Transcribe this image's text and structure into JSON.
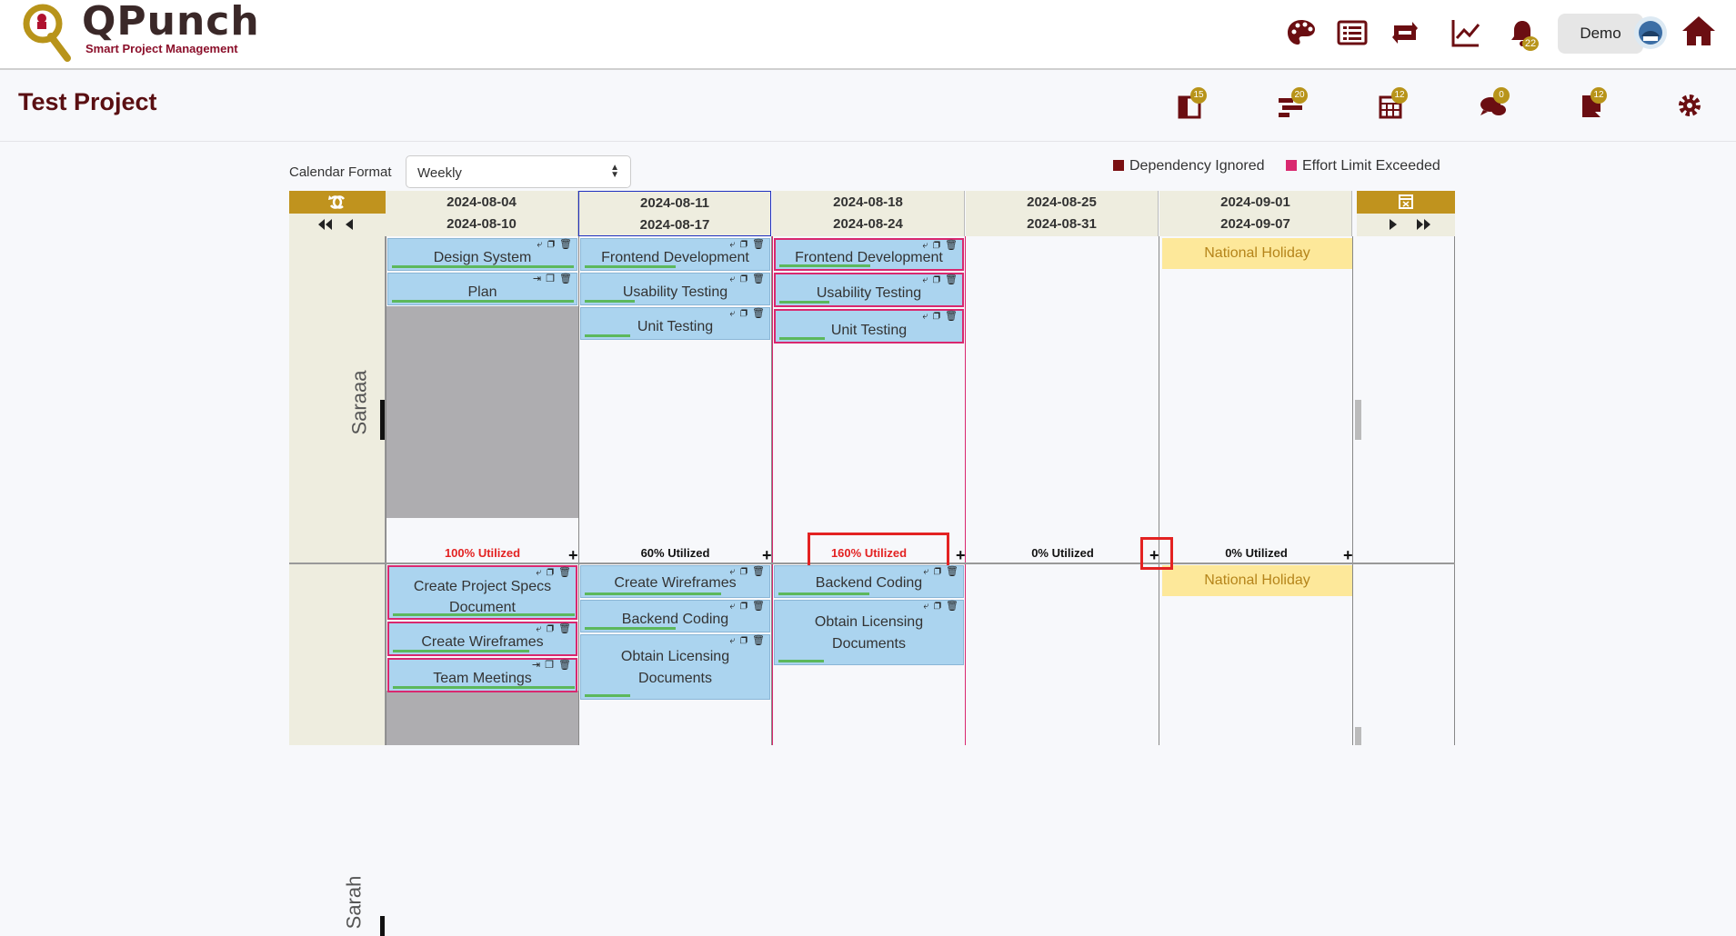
{
  "app": {
    "logo_title": "QPunch",
    "logo_subtitle": "Smart Project Management"
  },
  "topnav": {
    "demo_label": "Demo",
    "notification_count": "22",
    "icons": [
      "dashboard-icon",
      "list-icon",
      "repeat-icon",
      "chart-icon",
      "bell-icon",
      "avatar",
      "home-icon"
    ]
  },
  "project": {
    "title": "Test Project"
  },
  "project_toolbar": {
    "items": [
      {
        "icon": "tasks-board-icon",
        "count": "15"
      },
      {
        "icon": "gantt-icon",
        "count": "20"
      },
      {
        "icon": "calendar-icon",
        "count": "12"
      },
      {
        "icon": "chat-icon",
        "count": "0"
      },
      {
        "icon": "bookmark-icon",
        "count": "12"
      },
      {
        "icon": "gear-icon",
        "count": ""
      }
    ]
  },
  "calendar_format": {
    "label": "Calendar Format",
    "value": "Weekly"
  },
  "legend": [
    {
      "label": "Dependency Ignored",
      "color": "#7a0f12"
    },
    {
      "label": "Effort Limit Exceeded",
      "color": "#d9286f"
    }
  ],
  "weeks": [
    {
      "start": "2024-08-04",
      "end": "2024-08-10"
    },
    {
      "start": "2024-08-11",
      "end": "2024-08-17"
    },
    {
      "start": "2024-08-18",
      "end": "2024-08-24"
    },
    {
      "start": "2024-08-25",
      "end": "2024-08-31"
    },
    {
      "start": "2024-09-01",
      "end": "2024-09-07"
    }
  ],
  "users": [
    {
      "name": "Saraaa",
      "utilization": [
        "100% Utilized",
        "60% Utilized",
        "160% Utilized",
        "0% Utilized",
        "0% Utilized"
      ],
      "holiday": "National Holiday",
      "tasks": [
        [
          "Design System",
          "Plan"
        ],
        [
          "Frontend Development",
          "Usability Testing",
          "Unit Testing"
        ],
        [
          "Frontend Development",
          "Usability Testing",
          "Unit Testing"
        ],
        [],
        []
      ]
    },
    {
      "name": "Sarah",
      "holiday": "National Holiday",
      "tasks": [
        [
          "Create Project Specs Document",
          "Create Wireframes",
          "Team Meetings"
        ],
        [
          "Create Wireframes",
          "Backend Coding",
          "Obtain Licensing Documents"
        ],
        [
          "Backend Coding",
          "Obtain Licensing Documents"
        ],
        [],
        []
      ]
    }
  ]
}
